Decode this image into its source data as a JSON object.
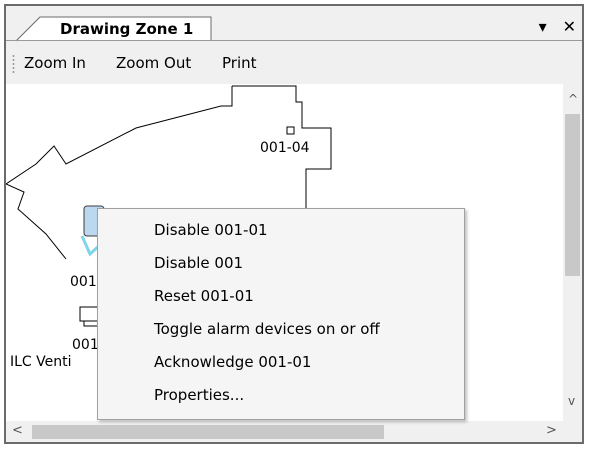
{
  "window": {
    "tab_title": "Drawing Zone 1",
    "dropdown_glyph": "▾",
    "close_glyph": "✕"
  },
  "toolbar": {
    "zoom_in": "Zoom In",
    "zoom_out": "Zoom Out",
    "print": "Print"
  },
  "drawing": {
    "device_label_1": "001-04",
    "device_label_2": "001",
    "device_label_3": "001-",
    "device_caption": "ILC Venti"
  },
  "context_menu": {
    "items": [
      "Disable 001-01",
      "Disable 001",
      "Reset 001-01",
      "Toggle alarm devices on or off",
      "Acknowledge 001-01",
      "Properties..."
    ]
  },
  "scrollbars": {
    "up": "^",
    "down": "v",
    "left": "<",
    "right": ">"
  },
  "colors": {
    "selection_highlight": "#7fd6e8",
    "selected_device_fill": "#bcd8f0"
  }
}
